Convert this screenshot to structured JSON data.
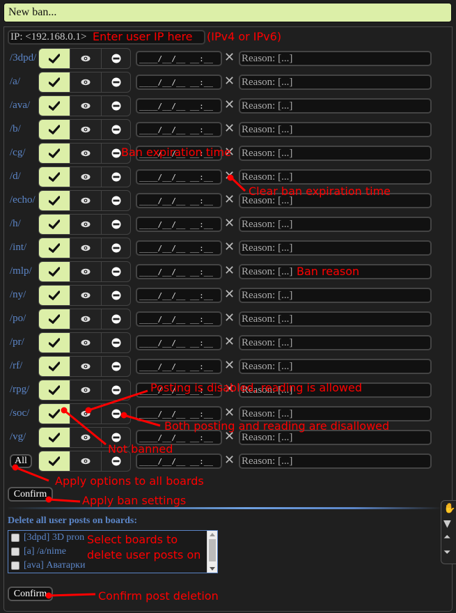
{
  "header": {
    "title": "New ban..."
  },
  "ip_field": {
    "value": "IP: <192.168.0.1>"
  },
  "boards": [
    {
      "label": "/3dpd/"
    },
    {
      "label": "/a/"
    },
    {
      "label": "/ava/"
    },
    {
      "label": "/b/"
    },
    {
      "label": "/cg/"
    },
    {
      "label": "/d/"
    },
    {
      "label": "/echo/"
    },
    {
      "label": "/h/"
    },
    {
      "label": "/int/"
    },
    {
      "label": "/mlp/"
    },
    {
      "label": "/ny/"
    },
    {
      "label": "/po/"
    },
    {
      "label": "/pr/"
    },
    {
      "label": "/rf/"
    },
    {
      "label": "/rpg/"
    },
    {
      "label": "/soc/"
    },
    {
      "label": "/vg/"
    }
  ],
  "row_defaults": {
    "selected_option": "not-banned",
    "date_mask": "____/__/__ __:__",
    "clear_glyph": "✕",
    "reason_placeholder": "Reason: [...]"
  },
  "all_row": {
    "label": "All"
  },
  "confirm_ban": {
    "label": "Confirm"
  },
  "delete_posts": {
    "label": "Delete all user posts on boards:",
    "items": [
      {
        "label": "[3dpd] 3D pron",
        "checked": false
      },
      {
        "label": "[a] /a/nime",
        "checked": false
      },
      {
        "label": "[ava] Аватарки",
        "checked": false
      }
    ],
    "confirm_label": "Confirm"
  },
  "annotations": {
    "ip": "Enter user IP here",
    "ip_hint": "(IPv4 or IPv6)",
    "expiration": "Ban expiration time",
    "clear": "Clear ban expiration time",
    "reason": "Ban reason",
    "read_only": "Posting is disabled, reading is allowed",
    "full_ban": "Both posting and reading are disallowed",
    "not_banned": "Not banned",
    "apply_all": "Apply options to all boards",
    "apply_ban": "Apply ban settings",
    "select_boards": "Select boards to",
    "select_boards_2": "delete user posts on",
    "confirm_delete": "Confirm post deletion"
  },
  "colors": {
    "accent": "#dcefa8",
    "link": "#5c86c8",
    "annotation": "#ff0000"
  }
}
